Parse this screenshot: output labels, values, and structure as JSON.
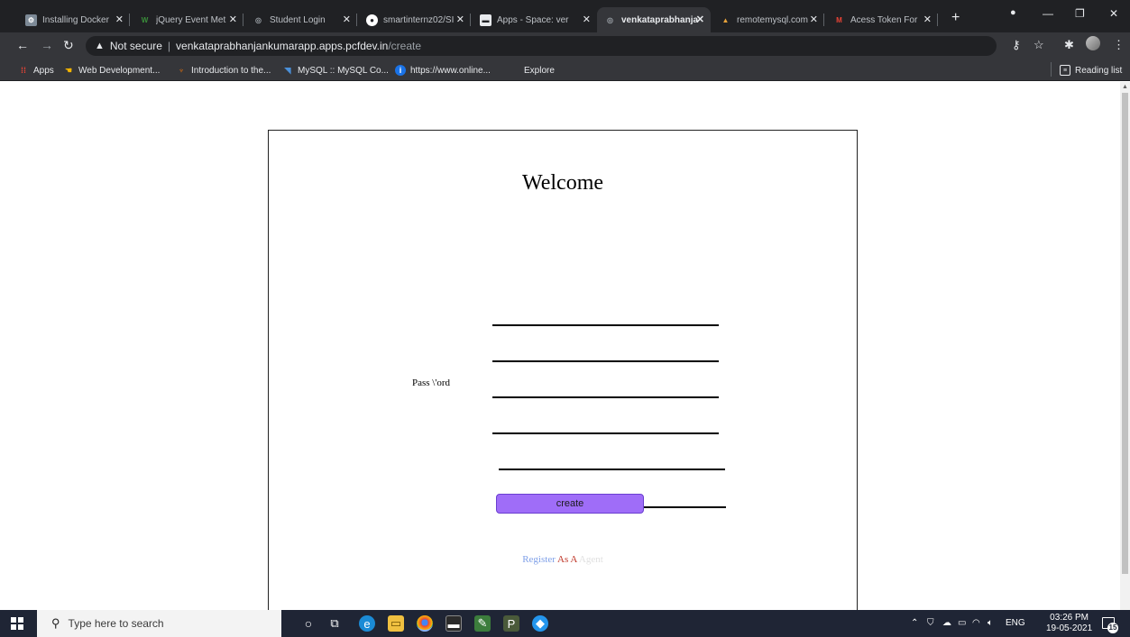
{
  "browser": {
    "tabs": [
      {
        "title": "Installing Docker",
        "favicon_color": "#7d8a97",
        "favicon_glyph": "⚙"
      },
      {
        "title": "jQuery Event Met",
        "favicon_color": "#3a8f3a",
        "favicon_glyph": "W"
      },
      {
        "title": "Student Login",
        "favicon_color": "#5f6368",
        "favicon_glyph": "◎"
      },
      {
        "title": "smartinternz02/SI",
        "favicon_color": "#ffffff",
        "favicon_glyph": "◉"
      },
      {
        "title": "Apps - Space: ver",
        "favicon_color": "#e8eaed",
        "favicon_glyph": "▬"
      },
      {
        "title": "venkataprabhanja",
        "favicon_color": "#5f6368",
        "favicon_glyph": "◎"
      },
      {
        "title": "remotemysql.com",
        "favicon_color": "#e8a33b",
        "favicon_glyph": "▲"
      },
      {
        "title": "Acess Token For",
        "favicon_color": "#ea4335",
        "favicon_glyph": "M"
      }
    ],
    "active_tab_index": 5,
    "address": {
      "security_label": "Not secure",
      "host": "venkataprabhanjankumarapp.apps.pcfdev.in",
      "path": "/create"
    },
    "bookmarks": [
      {
        "label": "Apps",
        "icon_color": "#ea4335"
      },
      {
        "label": "Web Development...",
        "icon_color": "#f4b400"
      },
      {
        "label": "Introduction to the...",
        "icon_color": "#e8710a"
      },
      {
        "label": "MySQL :: MySQL Co...",
        "icon_color": "#4a90d9"
      },
      {
        "label": "https://www.online...",
        "icon_color": "#1a73e8"
      },
      {
        "label": "Explore",
        "icon_color": "#35363a"
      }
    ],
    "reading_list_label": "Reading list"
  },
  "page": {
    "heading": "Welcome",
    "password_label": "Pass \\'ord",
    "create_button_label": "create",
    "register_link": {
      "word1": "Register",
      "word2": "As A",
      "word3": "Agent"
    }
  },
  "taskbar": {
    "search_placeholder": "Type here to search",
    "language": "ENG",
    "time": "03:26 PM",
    "date": "19-05-2021",
    "notification_count": "15"
  }
}
